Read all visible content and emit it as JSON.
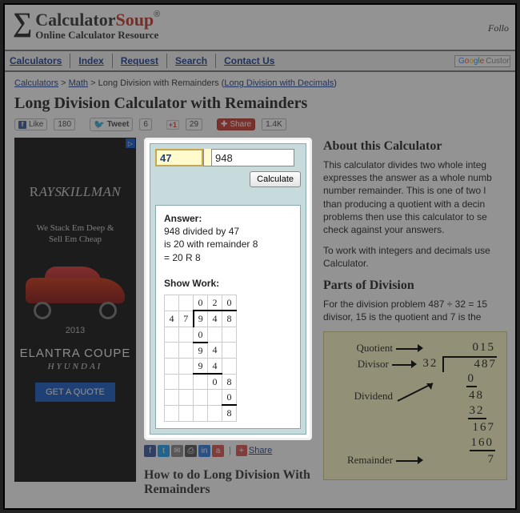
{
  "header": {
    "brand1": "Calculator",
    "brand2": "Soup",
    "tagline": "Online Calculator Resource",
    "follow": "Follo"
  },
  "nav": {
    "items": [
      "Calculators",
      "Index",
      "Request",
      "Search",
      "Contact Us"
    ],
    "search_placeholder": "Custom"
  },
  "breadcrumbs": {
    "a": "Calculators",
    "b": "Math",
    "c_text": "Long Division with Remainders",
    "c_link": "Long Division with Decimals"
  },
  "page_title": "Long Division Calculator with Remainders",
  "social": {
    "like": "Like",
    "like_count": "180",
    "tweet": "Tweet",
    "tweet_count": "6",
    "gplus": "+1",
    "gplus_count": "29",
    "share": "Share",
    "share_count": "1.4K"
  },
  "ad": {
    "brand": "RAYSKILLMAN",
    "line1": "We Stack Em Deep &",
    "line2": "Sell Em Cheap",
    "year": "2013",
    "model": "ELANTRA COUPE",
    "make": "HYUNDAI",
    "cta": "GET A QUOTE"
  },
  "calc": {
    "divisor": "47",
    "dividend": "948",
    "button": "Calculate",
    "answer_label": "Answer:",
    "answer_line1": "948 divided by 47",
    "answer_line2": "is 20 with remainder 8",
    "answer_line3": "= 20 R 8",
    "work_label": "Show Work:",
    "work": {
      "quotient": [
        "0",
        "2",
        "0"
      ],
      "divisor_digits": [
        "4",
        "7"
      ],
      "dividend_digits": [
        "9",
        "4",
        "8"
      ],
      "steps": [
        {
          "digits": [
            "0",
            "",
            ""
          ],
          "underline": [
            0
          ]
        },
        {
          "digits": [
            "9",
            "4",
            ""
          ],
          "underline": []
        },
        {
          "digits": [
            "9",
            "4",
            ""
          ],
          "underline": [
            0,
            1
          ]
        },
        {
          "digits": [
            "",
            "0",
            "8"
          ],
          "underline": []
        },
        {
          "digits": [
            "",
            "",
            "0"
          ],
          "underline": [
            2
          ]
        },
        {
          "digits": [
            "",
            "",
            "8"
          ],
          "underline": []
        }
      ]
    }
  },
  "share2": {
    "label": "Share"
  },
  "about": {
    "h": "About this Calculator",
    "p1": "This calculator divides two whole integ expresses the answer as a whole numb number remainder. This is one of two l than producing a quotient with a decin problems then use this calculator to se check against your answers.",
    "p2": "To work with integers and decimals use Calculator."
  },
  "parts": {
    "h": "Parts of Division",
    "intro": "For the division problem 487 ÷ 32 = 15 divisor, 15 is the quotient and 7 is the",
    "quotient_label": "Quotient",
    "divisor_label": "Divisor",
    "dividend_label": "Dividend",
    "remainder_label": "Remainder",
    "quotient": "015",
    "divisor": "32",
    "dividend": "487",
    "s1": "0",
    "s2": "48",
    "s3": "32",
    "s4": "167",
    "s5": "160",
    "remainder": "7"
  },
  "howto_h": "How to do Long Division With Remainders"
}
